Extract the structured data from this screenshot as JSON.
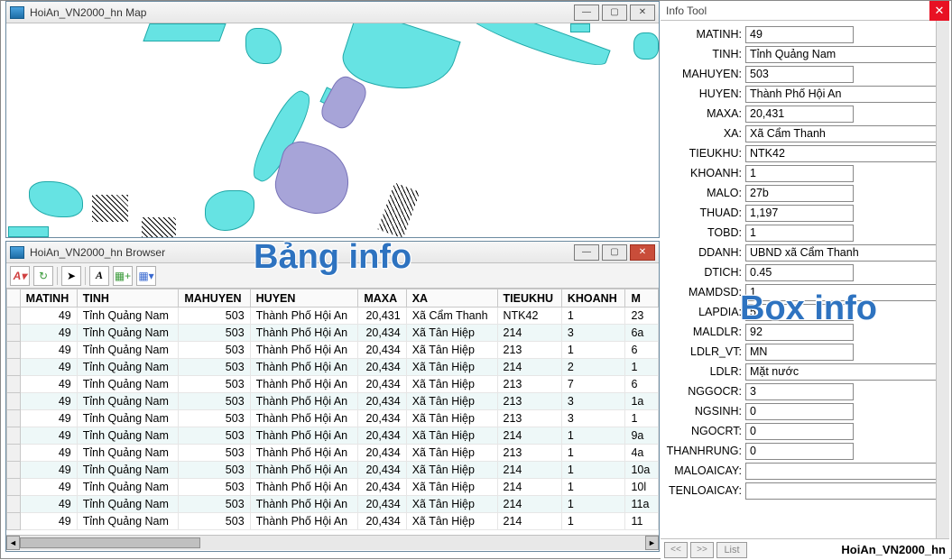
{
  "overlays": {
    "bang_info": "Bảng info",
    "box_info": "Box info"
  },
  "map_window": {
    "title": "HoiAn_VN2000_hn Map"
  },
  "browser_window": {
    "title": "HoiAn_VN2000_hn Browser",
    "columns": [
      "MATINH",
      "TINH",
      "MAHUYEN",
      "HUYEN",
      "MAXA",
      "XA",
      "TIEUKHU",
      "KHOANH",
      "M"
    ],
    "rows": [
      {
        "MATINH": "49",
        "TINH": "Tỉnh Quảng Nam",
        "MAHUYEN": "503",
        "HUYEN": "Thành Phố Hội An",
        "MAXA": "20,431",
        "XA": "Xã Cẩm Thanh",
        "TIEUKHU": "NTK42",
        "KHOANH": "1",
        "M": "23"
      },
      {
        "MATINH": "49",
        "TINH": "Tỉnh Quảng Nam",
        "MAHUYEN": "503",
        "HUYEN": "Thành Phố Hội An",
        "MAXA": "20,434",
        "XA": "Xã Tân Hiệp",
        "TIEUKHU": "214",
        "KHOANH": "3",
        "M": "6a"
      },
      {
        "MATINH": "49",
        "TINH": "Tỉnh Quảng Nam",
        "MAHUYEN": "503",
        "HUYEN": "Thành Phố Hội An",
        "MAXA": "20,434",
        "XA": "Xã Tân Hiệp",
        "TIEUKHU": "213",
        "KHOANH": "1",
        "M": "6"
      },
      {
        "MATINH": "49",
        "TINH": "Tỉnh Quảng Nam",
        "MAHUYEN": "503",
        "HUYEN": "Thành Phố Hội An",
        "MAXA": "20,434",
        "XA": "Xã Tân Hiệp",
        "TIEUKHU": "214",
        "KHOANH": "2",
        "M": "1"
      },
      {
        "MATINH": "49",
        "TINH": "Tỉnh Quảng Nam",
        "MAHUYEN": "503",
        "HUYEN": "Thành Phố Hội An",
        "MAXA": "20,434",
        "XA": "Xã Tân Hiệp",
        "TIEUKHU": "213",
        "KHOANH": "7",
        "M": "6"
      },
      {
        "MATINH": "49",
        "TINH": "Tỉnh Quảng Nam",
        "MAHUYEN": "503",
        "HUYEN": "Thành Phố Hội An",
        "MAXA": "20,434",
        "XA": "Xã Tân Hiệp",
        "TIEUKHU": "213",
        "KHOANH": "3",
        "M": "1a"
      },
      {
        "MATINH": "49",
        "TINH": "Tỉnh Quảng Nam",
        "MAHUYEN": "503",
        "HUYEN": "Thành Phố Hội An",
        "MAXA": "20,434",
        "XA": "Xã Tân Hiệp",
        "TIEUKHU": "213",
        "KHOANH": "3",
        "M": "1"
      },
      {
        "MATINH": "49",
        "TINH": "Tỉnh Quảng Nam",
        "MAHUYEN": "503",
        "HUYEN": "Thành Phố Hội An",
        "MAXA": "20,434",
        "XA": "Xã Tân Hiệp",
        "TIEUKHU": "214",
        "KHOANH": "1",
        "M": "9a"
      },
      {
        "MATINH": "49",
        "TINH": "Tỉnh Quảng Nam",
        "MAHUYEN": "503",
        "HUYEN": "Thành Phố Hội An",
        "MAXA": "20,434",
        "XA": "Xã Tân Hiệp",
        "TIEUKHU": "213",
        "KHOANH": "1",
        "M": "4a"
      },
      {
        "MATINH": "49",
        "TINH": "Tỉnh Quảng Nam",
        "MAHUYEN": "503",
        "HUYEN": "Thành Phố Hội An",
        "MAXA": "20,434",
        "XA": "Xã Tân Hiệp",
        "TIEUKHU": "214",
        "KHOANH": "1",
        "M": "10a"
      },
      {
        "MATINH": "49",
        "TINH": "Tỉnh Quảng Nam",
        "MAHUYEN": "503",
        "HUYEN": "Thành Phố Hội An",
        "MAXA": "20,434",
        "XA": "Xã Tân Hiệp",
        "TIEUKHU": "214",
        "KHOANH": "1",
        "M": "10l"
      },
      {
        "MATINH": "49",
        "TINH": "Tỉnh Quảng Nam",
        "MAHUYEN": "503",
        "HUYEN": "Thành Phố Hội An",
        "MAXA": "20,434",
        "XA": "Xã Tân Hiệp",
        "TIEUKHU": "214",
        "KHOANH": "1",
        "M": "11a"
      },
      {
        "MATINH": "49",
        "TINH": "Tỉnh Quảng Nam",
        "MAHUYEN": "503",
        "HUYEN": "Thành Phố Hội An",
        "MAXA": "20,434",
        "XA": "Xã Tân Hiệp",
        "TIEUKHU": "214",
        "KHOANH": "1",
        "M": "11"
      }
    ]
  },
  "info_tool": {
    "title": "Info Tool",
    "footer": {
      "list_label": "List",
      "dataset": "HoiAn_VN2000_hn"
    },
    "fields": [
      {
        "label": "MATINH:",
        "value": "49"
      },
      {
        "label": "TINH:",
        "value": "Tỉnh Quảng Nam"
      },
      {
        "label": "MAHUYEN:",
        "value": "503"
      },
      {
        "label": "HUYEN:",
        "value": "Thành Phố Hội An"
      },
      {
        "label": "MAXA:",
        "value": "20,431"
      },
      {
        "label": "XA:",
        "value": "Xã Cẩm Thanh"
      },
      {
        "label": "TIEUKHU:",
        "value": "NTK42"
      },
      {
        "label": "KHOANH:",
        "value": "1"
      },
      {
        "label": "MALO:",
        "value": "27b"
      },
      {
        "label": "THUAD:",
        "value": "1,197"
      },
      {
        "label": "TOBD:",
        "value": "1"
      },
      {
        "label": "DDANH:",
        "value": "UBND xã  Cẩm Thanh"
      },
      {
        "label": "DTICH:",
        "value": "0.45"
      },
      {
        "label": "MAMDSD:",
        "value": "1"
      },
      {
        "label": "LAPDIA:",
        "value": "5"
      },
      {
        "label": "MALDLR:",
        "value": "92"
      },
      {
        "label": "LDLR_VT:",
        "value": "MN"
      },
      {
        "label": "LDLR:",
        "value": "Mặt nước"
      },
      {
        "label": "NGGOCR:",
        "value": "3"
      },
      {
        "label": "NGSINH:",
        "value": "0"
      },
      {
        "label": "NGOCRT:",
        "value": "0"
      },
      {
        "label": "THANHRUNG:",
        "value": "0"
      },
      {
        "label": "MALOAICAY:",
        "value": ""
      },
      {
        "label": "TENLOAICAY:",
        "value": ""
      }
    ]
  }
}
